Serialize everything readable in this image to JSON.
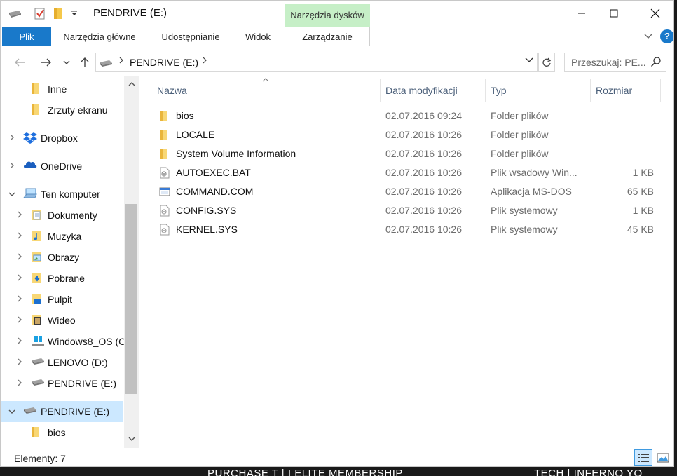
{
  "window": {
    "title": "PENDRIVE (E:)",
    "context_tab_group": "Narzędzia dysków",
    "context_tab": "Zarządzanie"
  },
  "ribbon": {
    "tabs": [
      "Plik",
      "Narzędzia główne",
      "Udostępnianie",
      "Widok"
    ],
    "accent": "#1979ca",
    "context_color": "#c6efc7"
  },
  "address": {
    "path": "PENDRIVE (E:)",
    "search_placeholder": "Przeszukaj: PE..."
  },
  "nav_tree": [
    {
      "label": "Inne",
      "icon": "folder-icon",
      "level": 2,
      "expandable": false
    },
    {
      "label": "Zrzuty ekranu",
      "icon": "folder-icon",
      "level": 2,
      "expandable": false
    },
    {
      "label": "Dropbox",
      "icon": "dropbox-icon",
      "level": 1,
      "expandable": true
    },
    {
      "label": "OneDrive",
      "icon": "onedrive-icon",
      "level": 1,
      "expandable": true
    },
    {
      "label": "Ten komputer",
      "icon": "computer-icon",
      "level": 1,
      "expandable": true,
      "expanded": true
    },
    {
      "label": "Dokumenty",
      "icon": "documents-icon",
      "level": 2,
      "expandable": true
    },
    {
      "label": "Muzyka",
      "icon": "music-icon",
      "level": 2,
      "expandable": true
    },
    {
      "label": "Obrazy",
      "icon": "pictures-icon",
      "level": 2,
      "expandable": true
    },
    {
      "label": "Pobrane",
      "icon": "downloads-icon",
      "level": 2,
      "expandable": true
    },
    {
      "label": "Pulpit",
      "icon": "desktop-icon",
      "level": 2,
      "expandable": true
    },
    {
      "label": "Wideo",
      "icon": "videos-icon",
      "level": 2,
      "expandable": true
    },
    {
      "label": "Windows8_OS (C",
      "icon": "windows-drive-icon",
      "level": 2,
      "expandable": true
    },
    {
      "label": "LENOVO (D:)",
      "icon": "drive-icon",
      "level": 2,
      "expandable": true
    },
    {
      "label": "PENDRIVE (E:)",
      "icon": "usb-drive-icon",
      "level": 2,
      "expandable": true
    },
    {
      "label": "PENDRIVE (E:)",
      "icon": "usb-drive-icon",
      "level": 1,
      "expandable": true,
      "expanded": true,
      "selected": true
    },
    {
      "label": "bios",
      "icon": "folder-icon",
      "level": 2,
      "expandable": false
    }
  ],
  "columns": {
    "name": "Nazwa",
    "date": "Data modyfikacji",
    "type": "Typ",
    "size": "Rozmiar"
  },
  "files": [
    {
      "name": "bios",
      "date": "02.07.2016 09:24",
      "type": "Folder plików",
      "size": "",
      "icon": "folder-icon"
    },
    {
      "name": "LOCALE",
      "date": "02.07.2016 10:26",
      "type": "Folder plików",
      "size": "",
      "icon": "folder-icon"
    },
    {
      "name": "System Volume Information",
      "date": "02.07.2016 10:26",
      "type": "Folder plików",
      "size": "",
      "icon": "folder-icon"
    },
    {
      "name": "AUTOEXEC.BAT",
      "date": "02.07.2016 10:26",
      "type": "Plik wsadowy Win...",
      "size": "1 KB",
      "icon": "batch-file-icon"
    },
    {
      "name": "COMMAND.COM",
      "date": "02.07.2016 10:26",
      "type": "Aplikacja MS-DOS",
      "size": "65 KB",
      "icon": "application-icon"
    },
    {
      "name": "CONFIG.SYS",
      "date": "02.07.2016 10:26",
      "type": "Plik systemowy",
      "size": "1 KB",
      "icon": "system-file-icon"
    },
    {
      "name": "KERNEL.SYS",
      "date": "02.07.2016 10:26",
      "type": "Plik systemowy",
      "size": "45 KB",
      "icon": "system-file-icon"
    }
  ],
  "status": {
    "item_count": "Elementy: 7"
  },
  "overlay": {
    "left_text": "PURCHASE T | I ELITE MEMBERSHIP",
    "right_text": "TECH | INFERNO YO"
  }
}
